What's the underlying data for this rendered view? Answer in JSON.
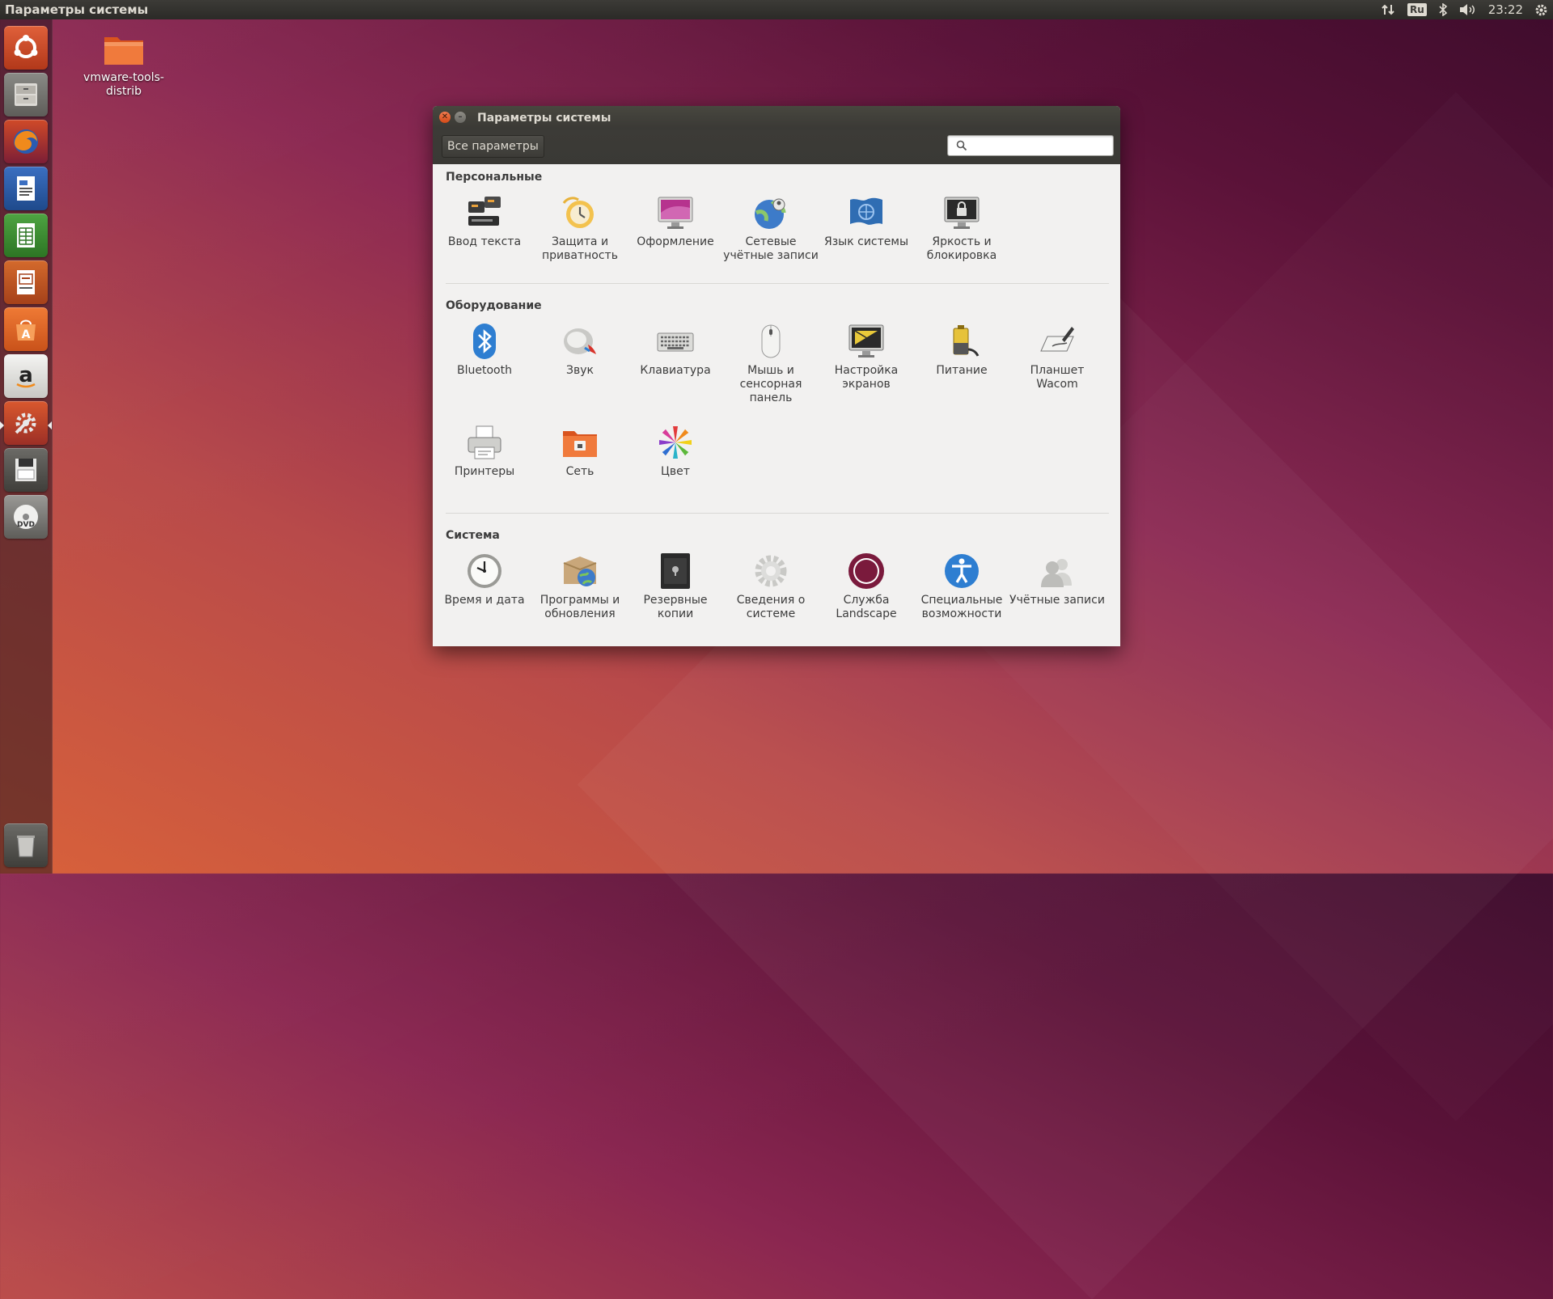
{
  "top_panel": {
    "title": "Параметры системы",
    "keyboard_layout": "Ru",
    "clock": "23:22"
  },
  "desktop": {
    "folder_label": "vmware-tools-distrib"
  },
  "window": {
    "title": "Параметры системы",
    "all_settings_label": "Все параметры",
    "search_placeholder": "",
    "sections": [
      {
        "title": "Персональные",
        "items": [
          {
            "label": "Ввод текста",
            "icon": "text-entry-icon"
          },
          {
            "label": "Защита и приватность",
            "icon": "privacy-icon"
          },
          {
            "label": "Оформление",
            "icon": "appearance-icon"
          },
          {
            "label": "Сетевые учётные записи",
            "icon": "online-accounts-icon"
          },
          {
            "label": "Язык системы",
            "icon": "language-icon"
          },
          {
            "label": "Яркость и блокировка",
            "icon": "brightness-lock-icon"
          }
        ]
      },
      {
        "title": "Оборудование",
        "items": [
          {
            "label": "Bluetooth",
            "icon": "bluetooth-icon"
          },
          {
            "label": "Звук",
            "icon": "sound-icon"
          },
          {
            "label": "Клавиатура",
            "icon": "keyboard-icon"
          },
          {
            "label": "Мышь и сенсорная панель",
            "icon": "mouse-icon"
          },
          {
            "label": "Настройка экранов",
            "icon": "displays-icon"
          },
          {
            "label": "Питание",
            "icon": "power-icon"
          },
          {
            "label": "Планшет Wacom",
            "icon": "wacom-tablet-icon"
          },
          {
            "label": "Принтеры",
            "icon": "printer-icon"
          },
          {
            "label": "Сеть",
            "icon": "network-icon"
          },
          {
            "label": "Цвет",
            "icon": "color-icon"
          }
        ]
      },
      {
        "title": "Система",
        "items": [
          {
            "label": "Время и дата",
            "icon": "clock-icon"
          },
          {
            "label": "Программы и обновления",
            "icon": "software-updates-icon"
          },
          {
            "label": "Резервные копии",
            "icon": "backup-icon"
          },
          {
            "label": "Сведения о системе",
            "icon": "system-info-icon"
          },
          {
            "label": "Служба Landscape",
            "icon": "landscape-icon"
          },
          {
            "label": "Специальные возможности",
            "icon": "accessibility-icon"
          },
          {
            "label": "Учётные записи",
            "icon": "user-accounts-icon"
          }
        ]
      }
    ]
  },
  "colors": {
    "ubuntu_orange": "#e95420",
    "panel_dark": "#3c3b37",
    "window_bg": "#f2f1f0"
  }
}
